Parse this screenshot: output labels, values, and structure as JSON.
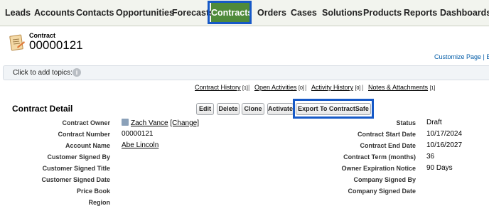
{
  "nav": {
    "tabs": [
      "Leads",
      "Accounts",
      "Contacts",
      "Opportunities",
      "Forecasts",
      "Contracts",
      "Orders",
      "Cases",
      "Solutions",
      "Products",
      "Reports",
      "Dashboards"
    ],
    "active": "Contracts",
    "accent_color": "#4f8a3a",
    "highlight_color": "#1659c7"
  },
  "record": {
    "type": "Contract",
    "name": "00000121",
    "icon": "contract-icon"
  },
  "customize_link": "Customize Page | Ed",
  "topics": {
    "label": "Click to add topics:",
    "icon": "info-icon"
  },
  "related_links": [
    {
      "label": "Contract History",
      "count": "[1]"
    },
    {
      "label": "Open Activities",
      "count": "[0]"
    },
    {
      "label": "Activity History",
      "count": "[0]"
    },
    {
      "label": "Notes & Attachments",
      "count": "[1]"
    }
  ],
  "detail": {
    "title": "Contract Detail",
    "buttons": [
      "Edit",
      "Delete",
      "Clone",
      "Activate",
      "Export To ContractSafe"
    ],
    "left_fields": [
      {
        "label": "Contract Owner",
        "value": "Zach Vance",
        "extra": "[Change]"
      },
      {
        "label": "Contract Number",
        "value": "00000121"
      },
      {
        "label": "Account Name",
        "value": "Abe Lincoln"
      },
      {
        "label": "Customer Signed By",
        "value": ""
      },
      {
        "label": "Customer Signed Title",
        "value": ""
      },
      {
        "label": "Customer Signed Date",
        "value": ""
      },
      {
        "label": "Price Book",
        "value": ""
      },
      {
        "label": "Region",
        "value": ""
      }
    ],
    "right_fields": [
      {
        "label": "Status",
        "value": "Draft"
      },
      {
        "label": "Contract Start Date",
        "value": "10/17/2024"
      },
      {
        "label": "Contract End Date",
        "value": "10/16/2027"
      },
      {
        "label": "Contract Term (months)",
        "value": "36"
      },
      {
        "label": "Owner Expiration Notice",
        "value": "90 Days"
      },
      {
        "label": "Company Signed By",
        "value": ""
      },
      {
        "label": "Company Signed Date",
        "value": ""
      }
    ]
  }
}
